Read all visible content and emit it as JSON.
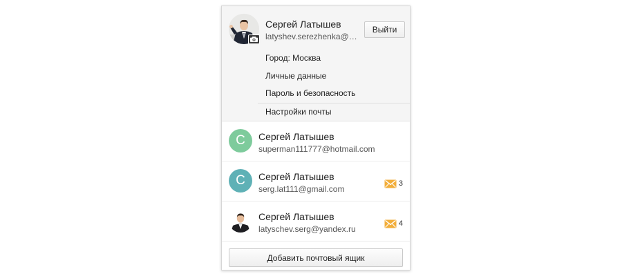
{
  "colors": {
    "avatar_green": "#7ecb9c",
    "avatar_teal": "#5fb1b6",
    "mail_icon": "#f2ae3a",
    "panel_top_bg": "#f5f5f5"
  },
  "icons": {
    "camera": "camera-icon",
    "mail": "envelope-icon"
  },
  "profile": {
    "name": "Сергей Латышев",
    "email": "latyshev.serezhenka@b...",
    "logout_label": "Выйти"
  },
  "menu": {
    "items": [
      {
        "label": "Город: Москва"
      },
      {
        "label": "Личные данные"
      },
      {
        "label": "Пароль и безопасность"
      },
      {
        "label": "Настройки почты"
      }
    ]
  },
  "accounts": [
    {
      "initial": "С",
      "name": "Сергей Латышев",
      "email": "superman111777@hotmail.com",
      "unread": null
    },
    {
      "initial": "С",
      "name": "Сергей Латышев",
      "email": "serg.lat111@gmail.com",
      "unread": "3"
    },
    {
      "initial": "",
      "name": "Сергей Латышев",
      "email": "latyschev.serg@yandex.ru",
      "unread": "4"
    }
  ],
  "add_mailbox_label": "Добавить почтовый ящик"
}
